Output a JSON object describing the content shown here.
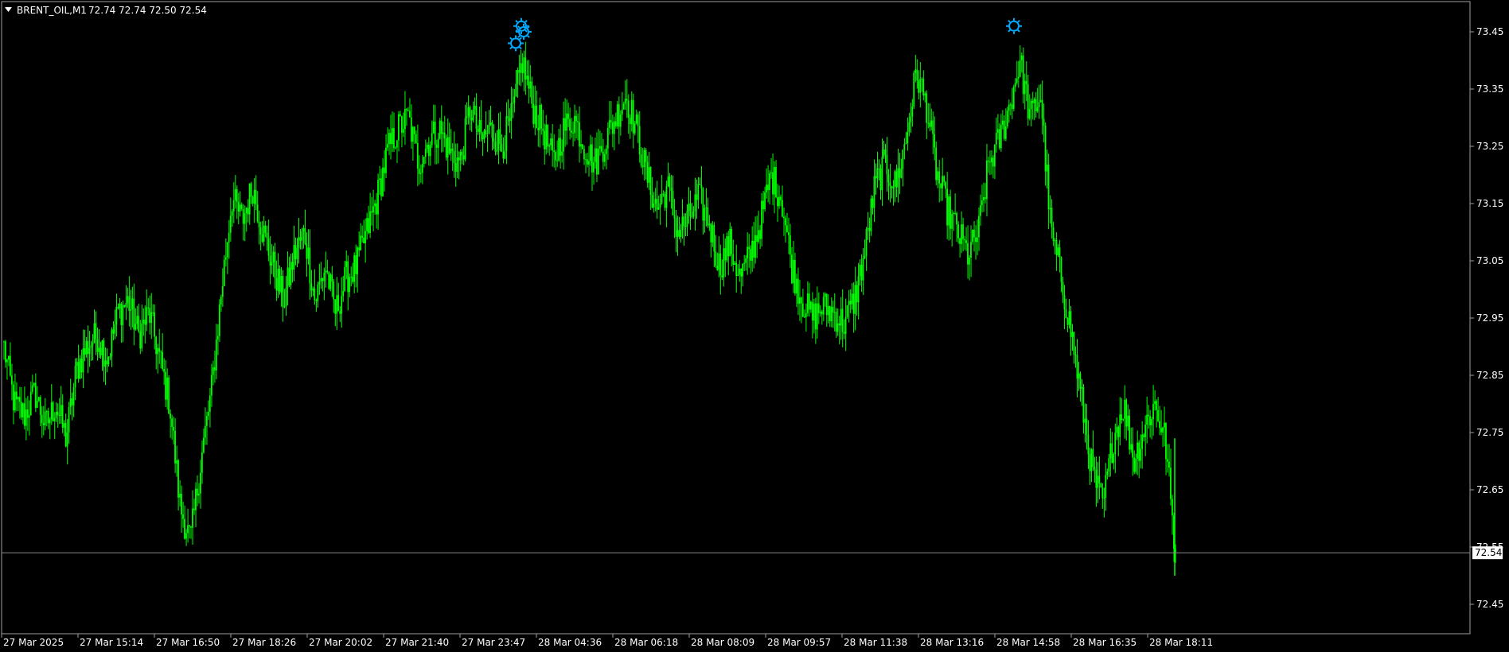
{
  "header": {
    "symbol_timeframe": "BRENT_OIL,M1",
    "ohlc": "72.74 72.74 72.50 72.54",
    "menu_triangle_icon": "triangle-down-icon"
  },
  "current_price_label": "72.54",
  "colors": {
    "background": "#000000",
    "grid_frame": "#a0a0a0",
    "candles": "#00ff00",
    "marker": "#00aaff",
    "text": "#ffffff",
    "price_line": "#8c8c8c"
  },
  "chart_data": {
    "type": "line",
    "x_tick_labels": [
      "27 Mar 2025",
      "27 Mar 15:14",
      "27 Mar 16:50",
      "27 Mar 18:26",
      "27 Mar 20:02",
      "27 Mar 21:40",
      "27 Mar 23:47",
      "28 Mar 04:36",
      "28 Mar 06:18",
      "28 Mar 08:09",
      "28 Mar 09:57",
      "28 Mar 11:38",
      "28 Mar 13:16",
      "28 Mar 14:58",
      "28 Mar 16:35",
      "28 Mar 18:11"
    ],
    "y_ticks": [
      "73.45",
      "73.35",
      "73.25",
      "73.15",
      "73.05",
      "72.95",
      "72.85",
      "72.75",
      "72.65",
      "72.55",
      "72.45"
    ],
    "ylim": [
      72.4,
      73.5
    ],
    "current_price": 72.54,
    "series": [
      {
        "values": [
          72.9,
          72.8,
          72.78,
          72.82,
          72.76,
          72.8,
          72.74,
          72.86,
          72.9,
          72.92,
          72.88,
          72.96,
          72.98,
          72.92,
          72.96,
          72.88,
          72.8,
          72.62,
          72.56,
          72.7,
          72.82,
          73.0,
          73.16,
          73.12,
          73.18,
          73.1,
          73.04,
          72.98,
          73.06,
          73.1,
          72.98,
          73.04,
          72.96,
          73.02,
          73.04,
          73.1,
          73.16,
          73.24,
          73.28,
          73.3,
          73.22,
          73.26,
          73.28,
          73.24,
          73.22,
          73.32,
          73.26,
          73.28,
          73.25,
          73.3,
          73.4,
          73.32,
          73.28,
          73.22,
          73.28,
          73.3,
          73.25,
          73.22,
          73.26,
          73.3,
          73.34,
          73.28,
          73.2,
          73.14,
          73.18,
          73.1,
          73.12,
          73.16,
          73.12,
          73.04,
          73.08,
          73.02,
          73.06,
          73.12,
          73.2,
          73.16,
          73.04,
          72.98,
          72.95,
          72.97,
          72.96,
          72.94,
          72.98,
          73.06,
          73.18,
          73.22,
          73.18,
          73.26,
          73.38,
          73.32,
          73.2,
          73.14,
          73.1,
          73.06,
          73.1,
          73.22,
          73.26,
          73.32,
          73.4,
          73.3,
          73.34,
          73.1,
          73.02,
          72.92,
          72.8,
          72.68,
          72.62,
          72.74,
          72.8,
          72.7,
          72.76,
          72.8,
          72.74,
          72.54
        ]
      }
    ],
    "markers": [
      {
        "type": "sun-marker-icon",
        "price": 73.43
      },
      {
        "type": "sun-marker-icon",
        "price": 73.45
      },
      {
        "type": "sun-marker-icon",
        "price": 73.46
      },
      {
        "type": "sun-marker-icon",
        "price": 73.46
      }
    ]
  }
}
